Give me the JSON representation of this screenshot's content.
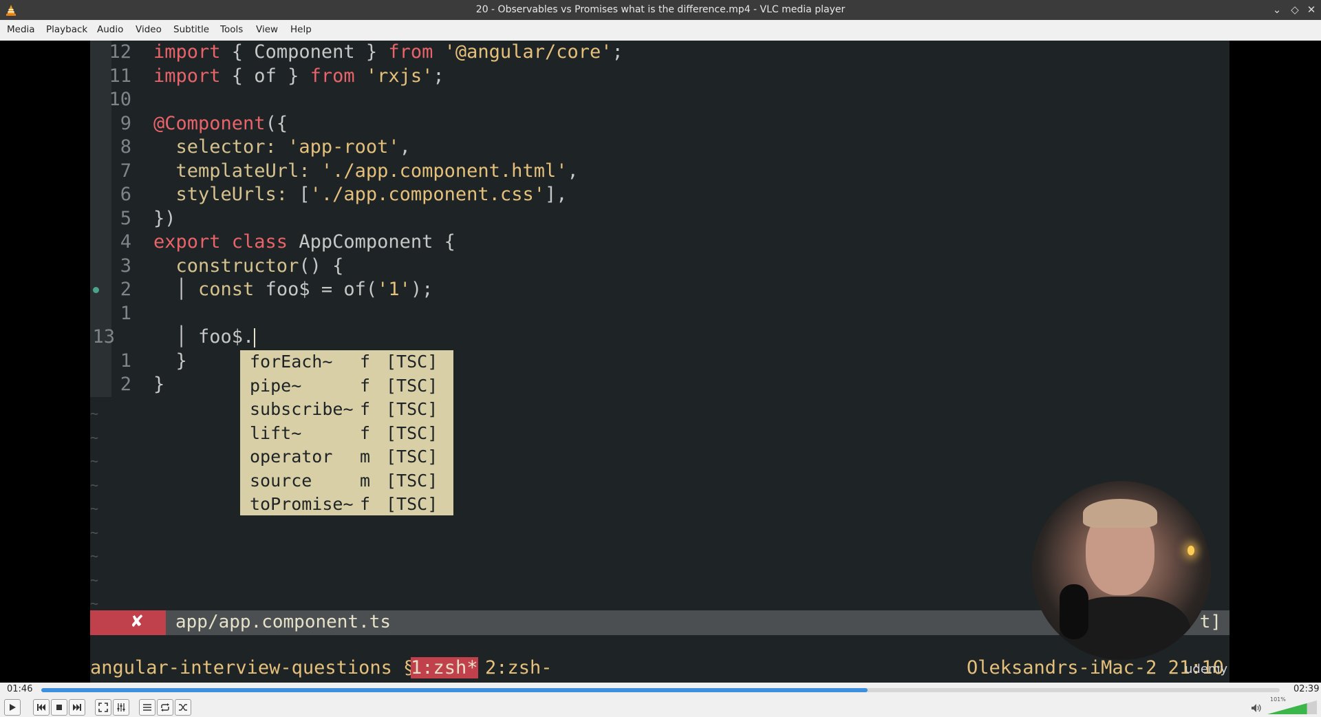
{
  "window": {
    "title": "20 - Observables vs Promises what is the difference.mp4 - VLC media player"
  },
  "menu": [
    "Media",
    "Playback",
    "Audio",
    "Video",
    "Subtitle",
    "Tools",
    "View",
    "Help"
  ],
  "editor": {
    "lines": [
      {
        "num": "12",
        "segments": [
          [
            "kw",
            "import "
          ],
          [
            "id",
            "{ Component } "
          ],
          [
            "kw",
            "from "
          ],
          [
            "str",
            "'@angular/core'"
          ],
          [
            "id",
            ";"
          ]
        ]
      },
      {
        "num": "11",
        "segments": [
          [
            "kw",
            "import "
          ],
          [
            "id",
            "{ of } "
          ],
          [
            "kw",
            "from "
          ],
          [
            "str",
            "'rxjs'"
          ],
          [
            "id",
            ";"
          ]
        ]
      },
      {
        "num": "10",
        "segments": []
      },
      {
        "num": "9",
        "segments": [
          [
            "kw",
            "@Component"
          ],
          [
            "id",
            "({"
          ]
        ]
      },
      {
        "num": "8",
        "segments": [
          [
            "prop",
            "  selector: "
          ],
          [
            "str",
            "'app-root'"
          ],
          [
            "id",
            ","
          ]
        ]
      },
      {
        "num": "7",
        "segments": [
          [
            "prop",
            "  templateUrl: "
          ],
          [
            "str",
            "'./app.component.html'"
          ],
          [
            "id",
            ","
          ]
        ]
      },
      {
        "num": "6",
        "segments": [
          [
            "prop",
            "  styleUrls: "
          ],
          [
            "id",
            "["
          ],
          [
            "str",
            "'./app.component.css'"
          ],
          [
            "id",
            "],"
          ]
        ]
      },
      {
        "num": "5",
        "segments": [
          [
            "id",
            "})"
          ]
        ]
      },
      {
        "num": "4",
        "segments": [
          [
            "kw",
            "export class "
          ],
          [
            "id",
            "AppComponent {"
          ]
        ]
      },
      {
        "num": "3",
        "segments": [
          [
            "prop",
            "  constructor"
          ],
          [
            "id",
            "() {"
          ]
        ]
      },
      {
        "num": "2",
        "segments": [
          [
            "id",
            "  │ "
          ],
          [
            "prop",
            "const "
          ],
          [
            "id",
            "foo$ = of("
          ],
          [
            "str",
            "'1'"
          ],
          [
            "id",
            ");"
          ]
        ]
      },
      {
        "num": "1",
        "segments": []
      },
      {
        "num": "13",
        "segments": [
          [
            "id",
            "  │ foo$."
          ]
        ]
      },
      {
        "num": "1",
        "segments": [
          [
            "id",
            "  }"
          ]
        ]
      },
      {
        "num": "2",
        "segments": [
          [
            "id",
            "}"
          ]
        ]
      }
    ],
    "autocomplete": [
      {
        "name": "forEach~",
        "kind": "f",
        "source": "[TSC]"
      },
      {
        "name": "pipe~",
        "kind": "f",
        "source": "[TSC]"
      },
      {
        "name": "subscribe~",
        "kind": "f",
        "source": "[TSC]"
      },
      {
        "name": "lift~",
        "kind": "f",
        "source": "[TSC]"
      },
      {
        "name": "operator",
        "kind": "m",
        "source": "[TSC]"
      },
      {
        "name": "source",
        "kind": "m",
        "source": "[TSC]"
      },
      {
        "name": "toPromise~",
        "kind": "f",
        "source": "[TSC]"
      }
    ],
    "status": {
      "error_mark": "✘",
      "filename": "app/app.component.ts",
      "right": "t]"
    },
    "tmux": {
      "session": "angular-interview-questions §",
      "window1": "1:zsh*",
      "window2": "2:zsh-",
      "host": "Oleksandrs-iMac-2 21:10"
    }
  },
  "watermark": "udemy",
  "playback": {
    "elapsed": "01:46",
    "total": "02:39",
    "progress_fraction": 0.667,
    "volume_label": "101%",
    "volume_fraction": 0.8
  }
}
